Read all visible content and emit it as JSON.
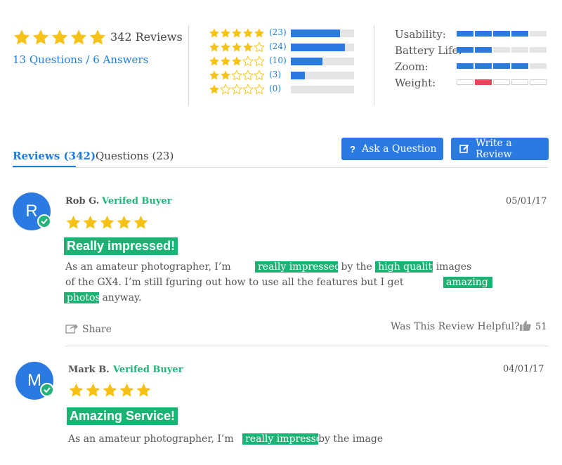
{
  "summary": {
    "rating_stars": 5,
    "reviews_count": "342 Reviews",
    "qa_link": "13 Questions / 6 Answers"
  },
  "histogram": [
    {
      "stars": 5,
      "count": "(23)",
      "fill": 0.78
    },
    {
      "stars": 4,
      "count": "(24)",
      "fill": 0.86
    },
    {
      "stars": 3,
      "count": "(10)",
      "fill": 0.5
    },
    {
      "stars": 2,
      "count": "(3)",
      "fill": 0.22
    },
    {
      "stars": 1,
      "count": "(0)",
      "fill": 0.0
    }
  ],
  "attributes": [
    {
      "label": "Usability:",
      "level": 4,
      "segments": 5,
      "color": "#2a7ae2"
    },
    {
      "label": "Battery Life:",
      "level": 2,
      "segments": 5,
      "color": "#2a7ae2"
    },
    {
      "label": "Zoom:",
      "level": 4,
      "segments": 5,
      "color": "#2a7ae2"
    },
    {
      "label": "Weight:",
      "level": 2,
      "segments": 5,
      "color": "#e8455a",
      "note": "second segment highlighted"
    }
  ],
  "tabs": {
    "reviews": "Reviews (342)",
    "questions": "Questions (23)"
  },
  "buttons": {
    "ask_question": "Ask a Question",
    "write_review": "Write a Review"
  },
  "reviews": [
    {
      "initial": "R",
      "name": "Rob G.",
      "verified_label": "Verifed Buyer",
      "date": "05/01/17",
      "stars": 5,
      "title": "Really impressed!",
      "text": {
        "p1": "As an amateur photographer, I’m",
        "h1": "really impressed",
        "p2": "by the",
        "h2": "high quality",
        "p3": "images",
        "p4": "of the GX4. I’m still fguring out how to use all the features but I get",
        "h3": "amazing",
        "h4": "photos",
        "p5": "anyway."
      },
      "share_label": "Share",
      "helpful_label": "Was This Review Helpful?",
      "helpful_count": "51"
    },
    {
      "initial": "M",
      "name": "Mark B.",
      "verified_label": "Verifed Buyer",
      "date": "04/01/17",
      "stars": 5,
      "title": "Amazing Service!",
      "text": {
        "p1": "As an amateur photographer, I’m",
        "h1": "really impressed",
        "p2": "by the image"
      }
    }
  ],
  "colors": {
    "star": "#f7c217",
    "star_empty_stroke": "#f7c217",
    "accent_blue": "#2a7ae2",
    "verified_green": "#21b47a",
    "highlight_green": "#1bb374",
    "weight_red": "#e8455a"
  }
}
